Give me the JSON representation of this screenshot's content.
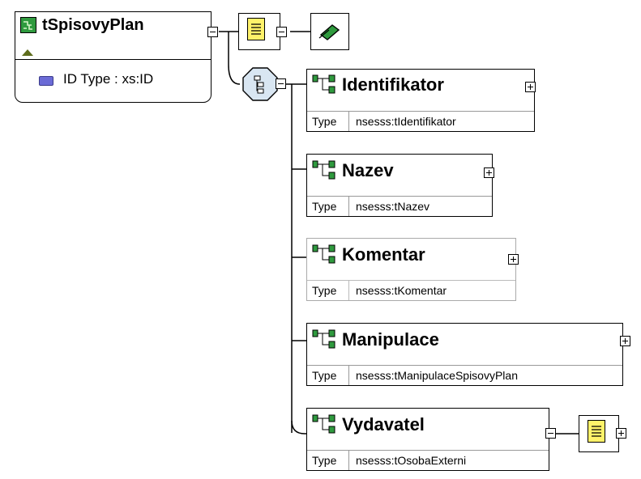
{
  "root": {
    "name": "tSpisovyPlan",
    "attribute": "ID Type : xs:ID"
  },
  "elements": [
    {
      "name": "Identifikator",
      "type_label": "Type",
      "type_value": "nsesss:tIdentifikator"
    },
    {
      "name": "Nazev",
      "type_label": "Type",
      "type_value": "nsesss:tNazev"
    },
    {
      "name": "Komentar",
      "type_label": "Type",
      "type_value": "nsesss:tKomentar"
    },
    {
      "name": "Manipulace",
      "type_label": "Type",
      "type_value": "nsesss:tManipulaceSpisovyPlan"
    },
    {
      "name": "Vydavatel",
      "type_label": "Type",
      "type_value": "nsesss:tOsobaExterni"
    }
  ],
  "colors": {
    "element_icon": "#2f9a3e",
    "annotation": "#fff26a",
    "sequence": "#d9e6f2",
    "attribute_icon": "#6b6bd6"
  },
  "icons": [
    "complex-type-icon",
    "annotation-icon",
    "documentation-icon",
    "sequence-icon",
    "element-icon",
    "attribute-icon"
  ]
}
